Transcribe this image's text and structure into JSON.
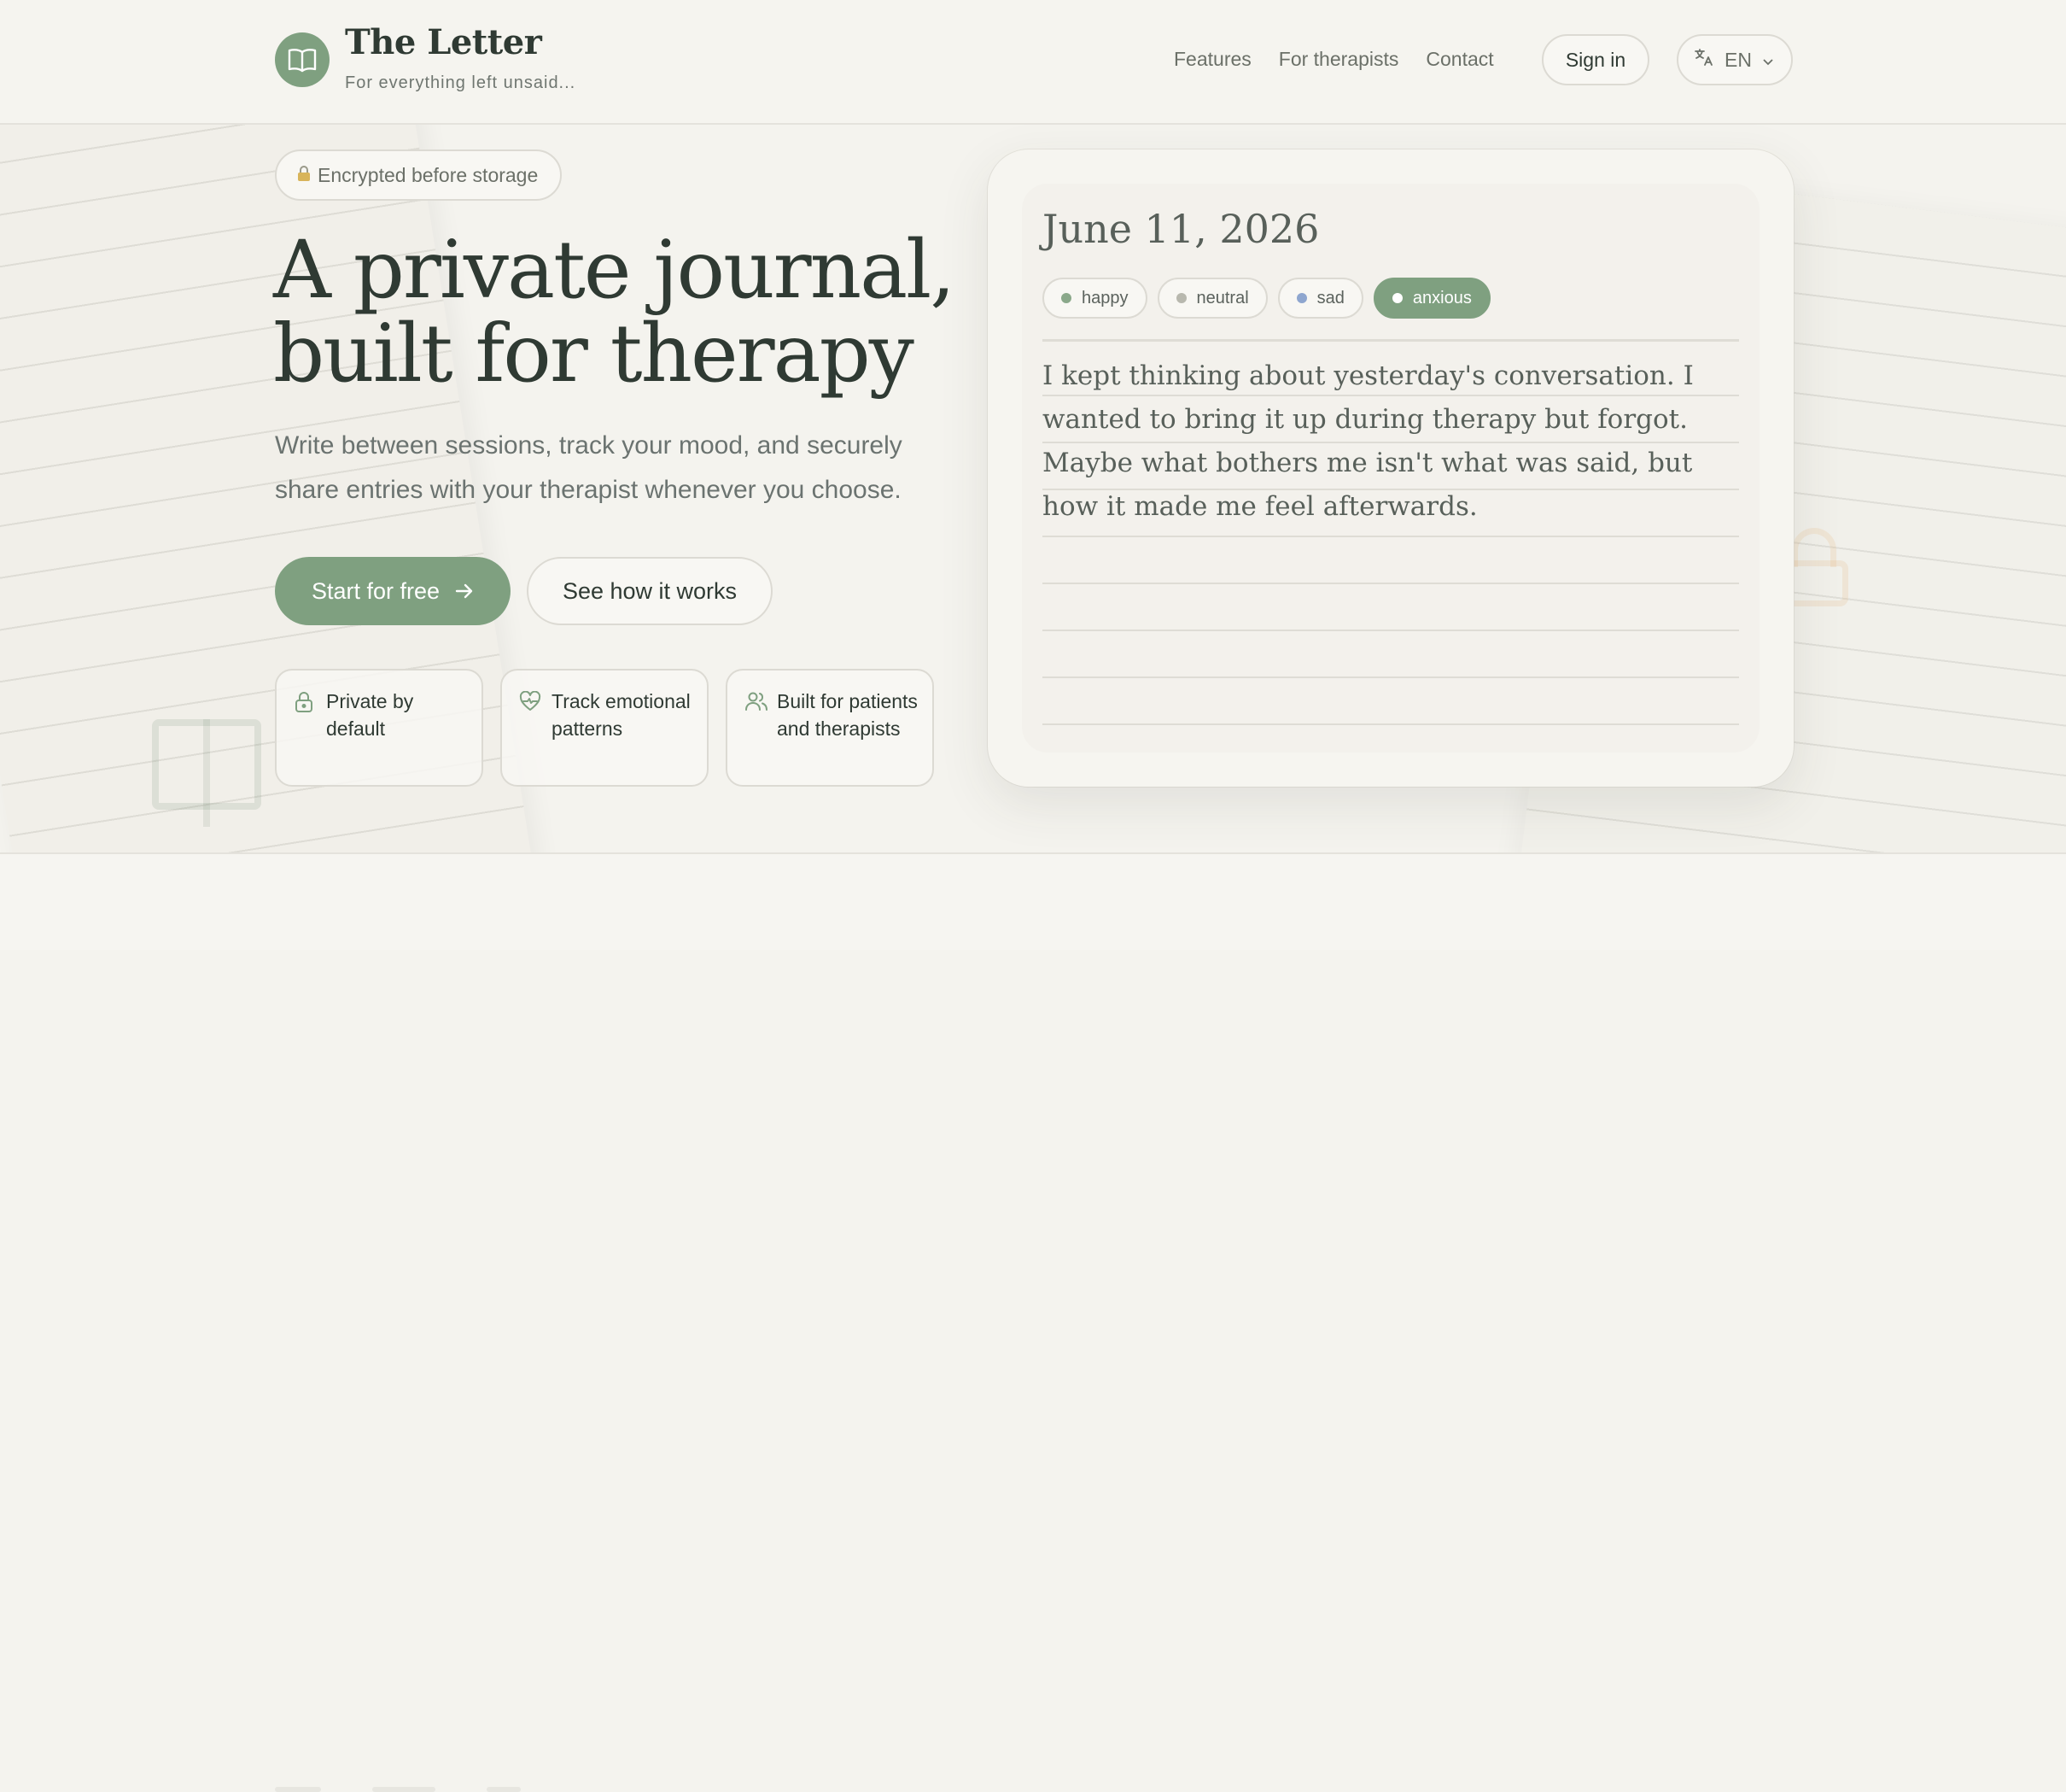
{
  "brand": {
    "title": "The Letter",
    "tagline": "For everything left unsaid..."
  },
  "nav": {
    "items": [
      {
        "label": "Features"
      },
      {
        "label": "For therapists"
      },
      {
        "label": "Contact"
      }
    ],
    "sign_in": "Sign in",
    "language": {
      "label": "EN",
      "icon": "translate-icon"
    }
  },
  "hero": {
    "badge": {
      "icon": "lock-icon",
      "label": "Encrypted before storage"
    },
    "title_line1": "A private journal,",
    "title_line2": "built for therapy",
    "subtitle": "Write between sessions, track your mood, and securely share entries with your therapist whenever you choose.",
    "cta_primary": "Start for free",
    "cta_secondary": "See how it works",
    "features": [
      {
        "icon": "lock-icon",
        "label": "Private by default"
      },
      {
        "icon": "heart-pulse-icon",
        "label": "Track emotional patterns"
      },
      {
        "icon": "users-icon",
        "label": "Built for patients and therapists"
      }
    ]
  },
  "journal": {
    "date": "June 11, 2026",
    "moods": [
      {
        "label": "happy",
        "color": "#8aa88a",
        "selected": false
      },
      {
        "label": "neutral",
        "color": "#b8b8ae",
        "selected": false
      },
      {
        "label": "sad",
        "color": "#8ea6cf",
        "selected": false
      },
      {
        "label": "anxious",
        "color": "#ffffff",
        "selected": true
      }
    ],
    "entry": "I kept thinking about yesterday's conversation. I wanted to bring it up during therapy but forgot. Maybe what bothers me isn't what was said, but how it made me feel afterwards."
  },
  "colors": {
    "accent": "#7fa080",
    "background": "#f4f3ee",
    "text": "#2f3a33"
  }
}
